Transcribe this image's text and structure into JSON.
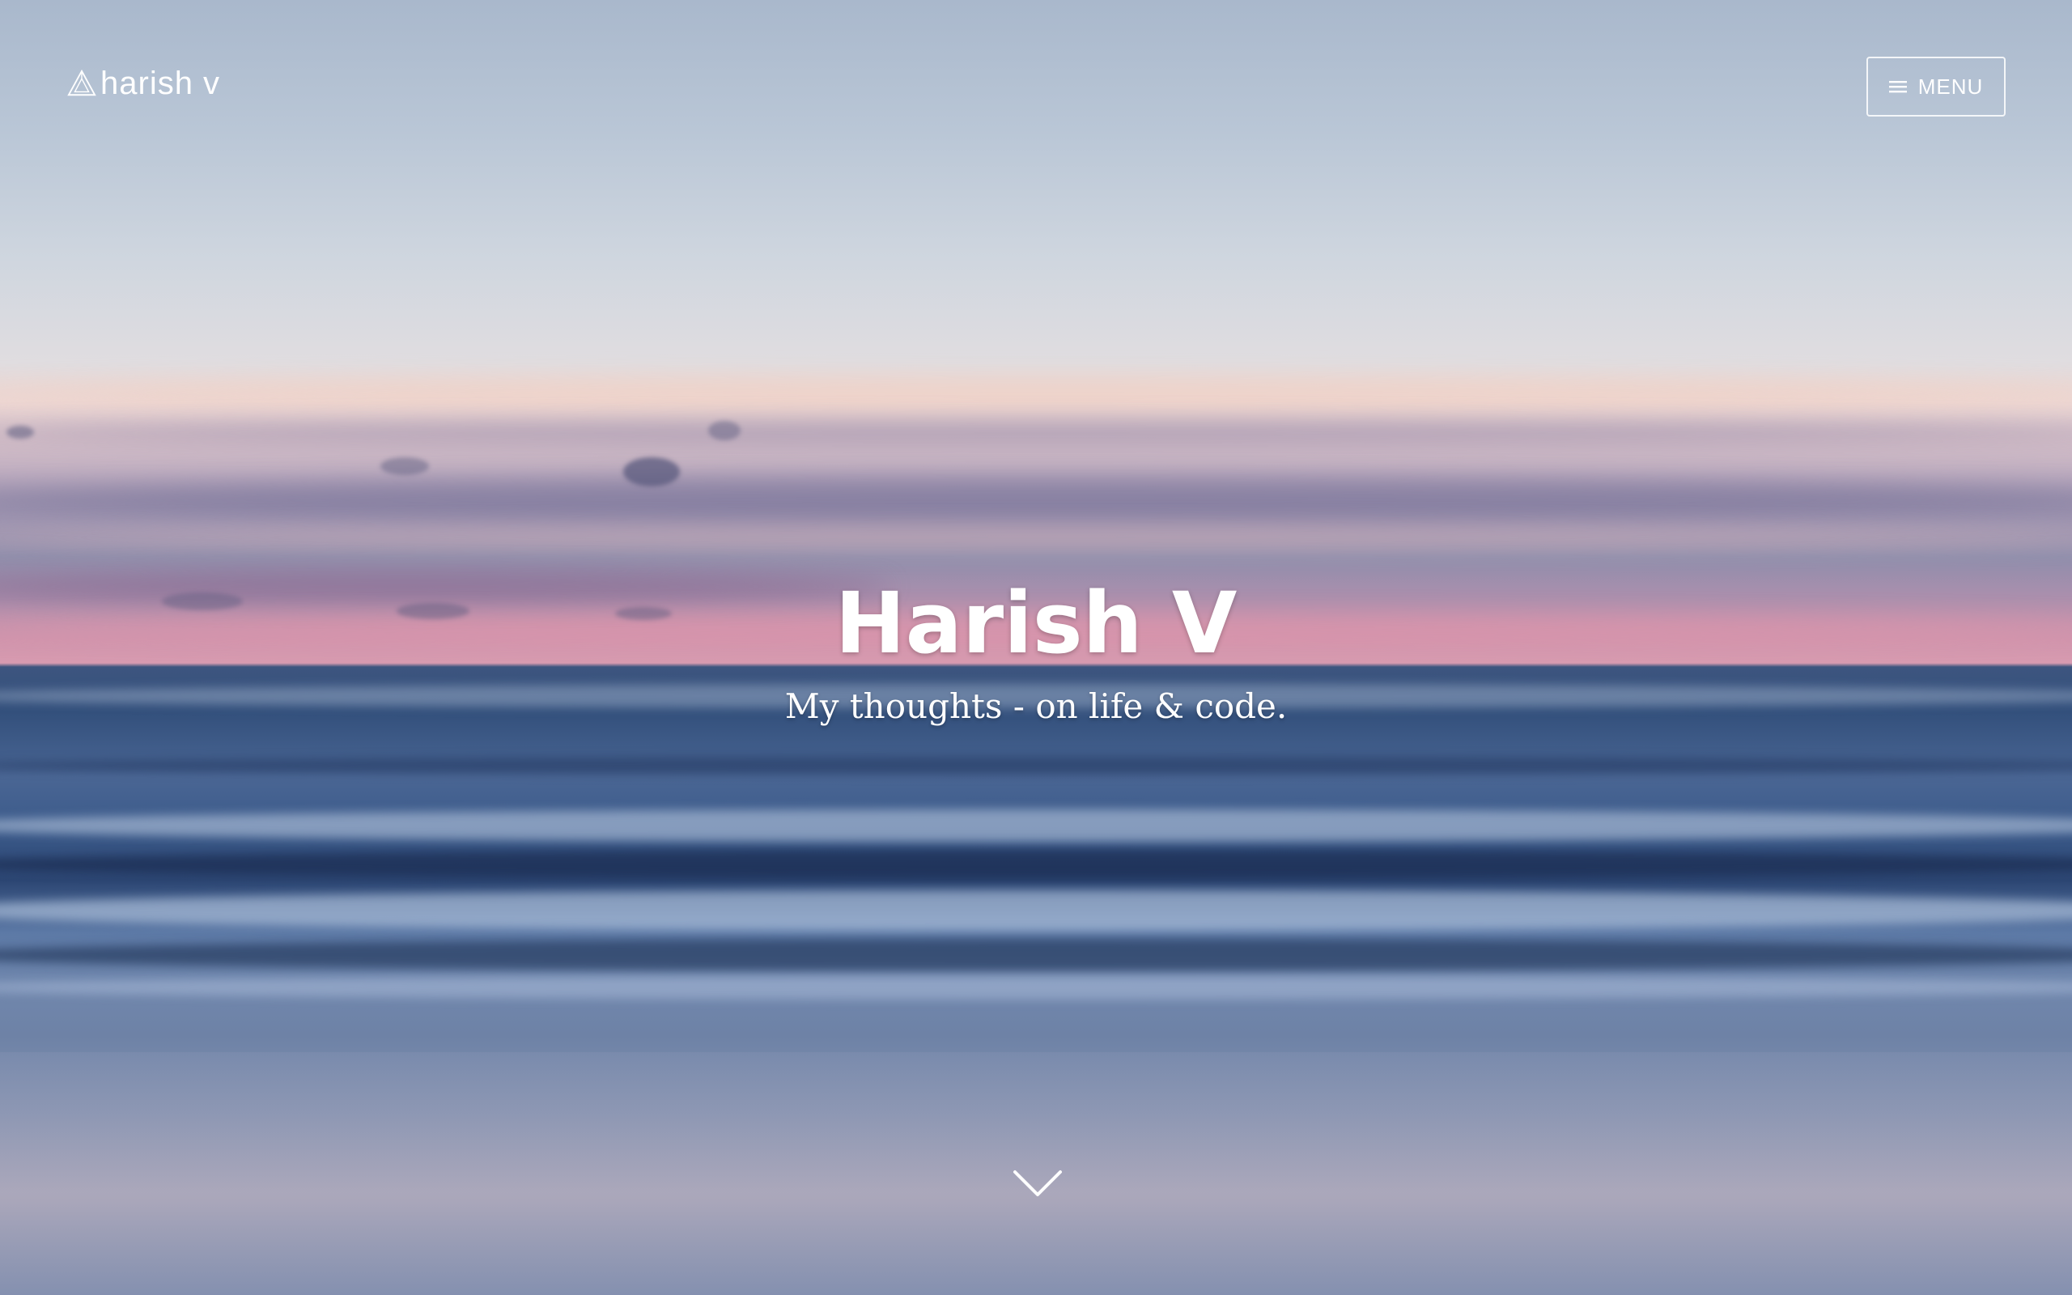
{
  "header": {
    "logo_text": "harish v",
    "logo_icon": "triangle-logo-icon",
    "menu_label": "MENU",
    "menu_icon": "hamburger-icon"
  },
  "hero": {
    "title": "Harish V",
    "subtitle": "My thoughts - on life & code.",
    "scroll_icon": "chevron-down-icon"
  },
  "colors": {
    "text": "#ffffff",
    "sky_top": "#a9b8cc",
    "horizon_pink": "#d89bb0",
    "sea": "#33507c"
  }
}
